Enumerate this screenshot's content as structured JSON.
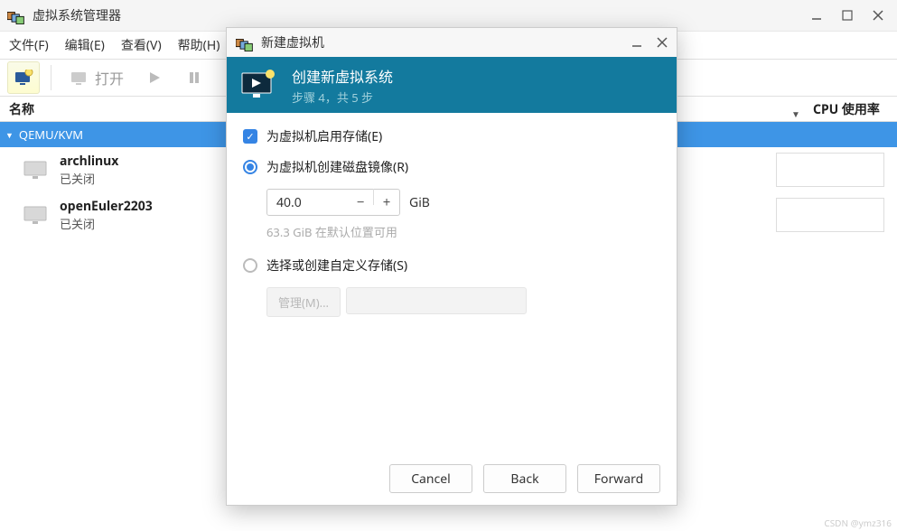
{
  "window": {
    "title": "虚拟系统管理器"
  },
  "menu": {
    "file": "文件(F)",
    "edit": "编辑(E)",
    "view": "查看(V)",
    "help": "帮助(H)"
  },
  "toolbar": {
    "open_label": "打开"
  },
  "columns": {
    "name": "名称",
    "cpu": "CPU 使用率"
  },
  "hypervisor": {
    "name": "QEMU/KVM"
  },
  "vms": [
    {
      "name": "archlinux",
      "status": "已关闭"
    },
    {
      "name": "openEuler2203",
      "status": "已关闭"
    }
  ],
  "dialog": {
    "title": "新建虚拟机",
    "banner_title": "创建新虚拟系统",
    "banner_step": "步骤 4，共 5 步",
    "enable_storage": "为虚拟机启用存储(E)",
    "create_disk": "为虚拟机创建磁盘镜像(R)",
    "size_value": "40.0",
    "size_unit": "GiB",
    "available": "63.3 GiB 在默认位置可用",
    "custom_storage": "选择或创建自定义存储(S)",
    "manage_btn": "管理(M)...",
    "cancel": "Cancel",
    "back": "Back",
    "forward": "Forward"
  },
  "watermark": "CSDN @ymz316"
}
